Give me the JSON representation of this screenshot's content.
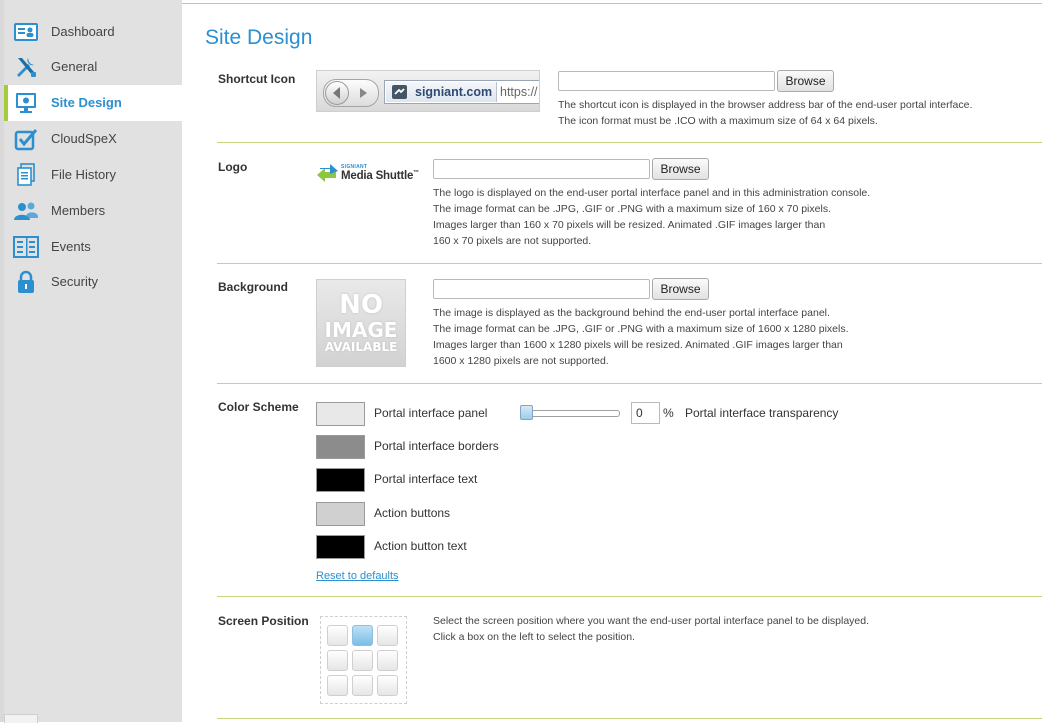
{
  "sidebar": {
    "items": [
      {
        "label": "Dashboard",
        "icon": "dashboard-icon"
      },
      {
        "label": "General",
        "icon": "tools-icon"
      },
      {
        "label": "Site Design",
        "icon": "monitor-icon"
      },
      {
        "label": "CloudSpeX",
        "icon": "checkbox-icon"
      },
      {
        "label": "File History",
        "icon": "document-history-icon"
      },
      {
        "label": "Members",
        "icon": "users-icon"
      },
      {
        "label": "Events",
        "icon": "events-list-icon"
      },
      {
        "label": "Security",
        "icon": "lock-icon"
      }
    ],
    "active_index": 2
  },
  "page": {
    "title": "Site Design"
  },
  "shortcut_icon": {
    "label": "Shortcut Icon",
    "preview_domain": "signiant.com",
    "preview_url": "https://",
    "browse_label": "Browse",
    "file_value": "",
    "desc": [
      "The shortcut icon is displayed in the browser address bar of the end-user portal interface.",
      "The icon format must be .ICO with a maximum size of 64 x 64 pixels."
    ]
  },
  "logo": {
    "label": "Logo",
    "logo_small_text": "SIGNIANT",
    "logo_text": "Media Shuttle",
    "logo_mark": "™",
    "browse_label": "Browse",
    "file_value": "",
    "desc": [
      "The logo is displayed on the end-user portal interface panel and in this administration console.",
      "The image format can be .JPG, .GIF or .PNG with a maximum size of 160 x 70 pixels.",
      "Images larger than 160 x 70 pixels will be resized. Animated .GIF images larger than",
      "160 x 70 pixels are not supported."
    ]
  },
  "background": {
    "label": "Background",
    "placeholder_lines": [
      "NO",
      "IMAGE",
      "AVAILABLE"
    ],
    "browse_label": "Browse",
    "file_value": "",
    "desc": [
      "The image is displayed as the background behind the end-user portal interface panel.",
      "The image format can be .JPG, .GIF or .PNG with a maximum size of 1600 x 1280 pixels.",
      "Images larger than 1600 x 1280 pixels will be resized. Animated .GIF images larger than",
      "1600 x 1280 pixels are not supported."
    ]
  },
  "color_scheme": {
    "label": "Color Scheme",
    "items": [
      {
        "label": "Portal interface panel",
        "color": "#e8e8e8"
      },
      {
        "label": "Portal interface borders",
        "color": "#8c8c8c"
      },
      {
        "label": "Portal interface text",
        "color": "#000000"
      },
      {
        "label": "Action buttons",
        "color": "#d0d0d0"
      },
      {
        "label": "Action button text",
        "color": "#000000"
      }
    ],
    "transparency_value": "0",
    "transparency_fraction": 0,
    "percent_sign": "%",
    "transparency_label": "Portal interface transparency",
    "reset_label": "Reset to defaults"
  },
  "screen_position": {
    "label": "Screen Position",
    "selected_cell": 1,
    "desc": [
      "Select the screen position where you want the end-user portal interface panel to be displayed.",
      "Click a box on the left to select the position."
    ]
  },
  "colors": {
    "accent_blue": "#2b8fd0",
    "active_bar": "#a4cc3a",
    "separator": "#c8d47c"
  }
}
